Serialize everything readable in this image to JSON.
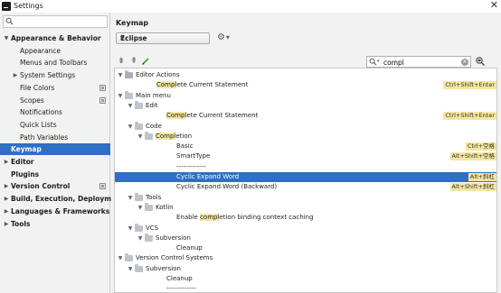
{
  "window": {
    "title": "Settings",
    "close": "✕"
  },
  "sidebar": {
    "search_placeholder": "",
    "items": [
      {
        "label": "Appearance & Behavior",
        "level": 0,
        "bold": true,
        "expanded": true,
        "arrow": "▼"
      },
      {
        "label": "Appearance",
        "level": 1
      },
      {
        "label": "Menus and Toolbars",
        "level": 1
      },
      {
        "label": "System Settings",
        "level": 1,
        "arrow": "▶"
      },
      {
        "label": "File Colors",
        "level": 1,
        "project": true
      },
      {
        "label": "Scopes",
        "level": 1,
        "project": true
      },
      {
        "label": "Notifications",
        "level": 1
      },
      {
        "label": "Quick Lists",
        "level": 1
      },
      {
        "label": "Path Variables",
        "level": 1
      },
      {
        "label": "Keymap",
        "level": 0,
        "bold": true,
        "selected": true
      },
      {
        "label": "Editor",
        "level": 0,
        "bold": true,
        "arrow": "▶"
      },
      {
        "label": "Plugins",
        "level": 0,
        "bold": true
      },
      {
        "label": "Version Control",
        "level": 0,
        "bold": true,
        "arrow": "▶",
        "project": true
      },
      {
        "label": "Build, Execution, Deployment",
        "level": 0,
        "bold": true,
        "arrow": "▶"
      },
      {
        "label": "Languages & Frameworks",
        "level": 0,
        "bold": true,
        "arrow": "▶"
      },
      {
        "label": "Tools",
        "level": 0,
        "bold": true,
        "arrow": "▶"
      }
    ]
  },
  "main": {
    "title": "Keymap",
    "scheme": "Eclipse",
    "find_value": "compl",
    "tree": [
      {
        "level": 0,
        "arrow": "▼",
        "icon": "editor-actions",
        "pre": "Editor Actions"
      },
      {
        "level": 1,
        "hl": "Compl",
        "post": "ete Current Statement",
        "shortcut": "Ctrl+Shift+Enter"
      },
      {
        "level": 0,
        "arrow": "▼",
        "icon": "folder",
        "pre": "Main menu"
      },
      {
        "level": 1,
        "arrow": "▼",
        "icon": "folder",
        "pre": "Edit"
      },
      {
        "level": 2,
        "hl": "Compl",
        "post": "ete Current Statement",
        "shortcut": "Ctrl+Shift+Enter"
      },
      {
        "level": 1,
        "arrow": "▼",
        "icon": "folder",
        "pre": "Code"
      },
      {
        "level": 2,
        "arrow": "▼",
        "icon": "folder",
        "hl": "Compl",
        "post": "etion"
      },
      {
        "level": 3,
        "pre": "Basic",
        "shortcut": "Ctrl+空格"
      },
      {
        "level": 3,
        "pre": "SmartType",
        "shortcut": "Alt+Shift+空格"
      },
      {
        "level": 3,
        "pre": "-------------"
      },
      {
        "level": 3,
        "pre": "Cyclic Expand Word",
        "shortcut": "Alt+斜杠",
        "selected": true
      },
      {
        "level": 3,
        "pre": "Cyclic Expand Word (Backward)",
        "shortcut": "Alt+Shift+斜杠"
      },
      {
        "level": 1,
        "arrow": "▼",
        "icon": "folder",
        "pre": "Tools"
      },
      {
        "level": 2,
        "arrow": "▼",
        "icon": "folder",
        "pre": "Kotlin"
      },
      {
        "level": 3,
        "pre": "Enable ",
        "hl": "compl",
        "post": "etion binding context caching"
      },
      {
        "level": 1,
        "arrow": "▼",
        "icon": "folder",
        "pre": "VCS"
      },
      {
        "level": 2,
        "arrow": "▼",
        "icon": "folder",
        "pre": "Subversion"
      },
      {
        "level": 3,
        "pre": "Cleanup"
      },
      {
        "level": 0,
        "arrow": "▼",
        "icon": "folder",
        "pre": "Version Control Systems"
      },
      {
        "level": 1,
        "arrow": "▼",
        "icon": "folder",
        "pre": "Subversion"
      },
      {
        "level": 2,
        "pre": "Cleanup"
      },
      {
        "level": 2,
        "pre": "-------------"
      }
    ]
  },
  "colors": {
    "selection": "#2f6fc4",
    "highlight": "#f4e6a0"
  }
}
